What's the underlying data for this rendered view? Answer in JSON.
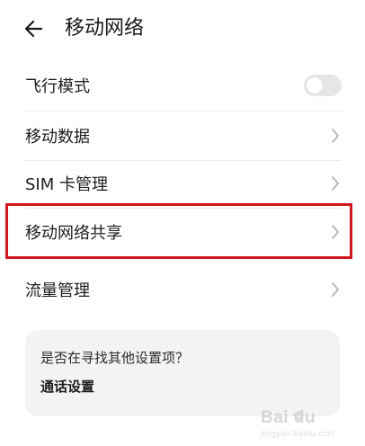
{
  "header": {
    "title": "移动网络",
    "back_icon": "arrow-left-icon"
  },
  "settings": {
    "airplane_mode": {
      "label": "飞行模式",
      "enabled": false
    },
    "mobile_data": {
      "label": "移动数据"
    },
    "sim_management": {
      "label": "SIM 卡管理"
    },
    "hotspot": {
      "label": "移动网络共享"
    },
    "data_usage": {
      "label": "流量管理"
    }
  },
  "suggestion_card": {
    "question": "是否在寻找其他设置项？",
    "link": "通话设置"
  },
  "watermark": {
    "text": "Bai du",
    "subtext": "jingyan.baidu.com"
  },
  "colors": {
    "highlight_border": "#d0161e",
    "toggle_off": "#e6e6e6",
    "card_background": "#f3f3f3",
    "chevron": "#b5b5b5"
  }
}
